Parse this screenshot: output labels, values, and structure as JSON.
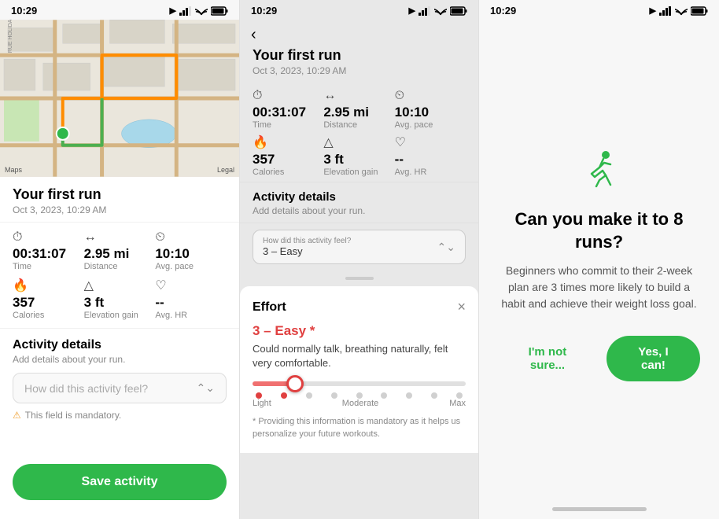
{
  "panel1": {
    "statusBar": {
      "time": "10:29",
      "locationIcon": "▶",
      "signal": "●●●",
      "wifi": "wifi",
      "battery": "battery"
    },
    "runTitle": "Your first run",
    "runDate": "Oct 3, 2023, 10:29 AM",
    "stats": [
      {
        "icon": "🕐",
        "value": "00:31:07",
        "label": "Time"
      },
      {
        "icon": "↔",
        "value": "2.95 mi",
        "label": "Distance"
      },
      {
        "icon": "⏱",
        "value": "10:10",
        "label": "Avg. pace"
      },
      {
        "icon": "🔥",
        "value": "357",
        "label": "Calories"
      },
      {
        "icon": "△",
        "value": "3 ft",
        "label": "Elevation gain"
      },
      {
        "icon": "♡",
        "value": "--",
        "label": "Avg. HR"
      }
    ],
    "activityDetails": {
      "title": "Activity details",
      "subtitle": "Add details about your run.",
      "dropdownPlaceholder": "How did this activity feel?",
      "mandatoryText": "This field is mandatory."
    },
    "saveButton": "Save activity",
    "legalText": "Legal",
    "appleMaps": "Maps"
  },
  "panel2": {
    "statusBar": {
      "time": "10:29"
    },
    "backLabel": "‹",
    "runTitle": "Your first run",
    "runDate": "Oct 3, 2023, 10:29 AM",
    "stats": [
      {
        "icon": "🕐",
        "value": "00:31:07",
        "label": "Time"
      },
      {
        "icon": "↔",
        "value": "2.95 mi",
        "label": "Distance"
      },
      {
        "icon": "⏱",
        "value": "10:10",
        "label": "Avg. pace"
      },
      {
        "icon": "🔥",
        "value": "357",
        "label": "Calories"
      },
      {
        "icon": "△",
        "value": "3 ft",
        "label": "Elevation gain"
      },
      {
        "icon": "♡",
        "value": "--",
        "label": "Avg. HR"
      }
    ],
    "activityDetails": {
      "title": "Activity details",
      "subtitle": "Add details about your run."
    },
    "dropdownLabel": "How did this activity feel?",
    "dropdownValue": "3 – Easy",
    "effortSheet": {
      "title": "Effort",
      "closeIcon": "×",
      "level": "3 – Easy *",
      "description": "Could normally talk, breathing naturally, felt very comfortable.",
      "sliderLabels": {
        "left": "Light",
        "center": "Moderate",
        "right": "Max"
      },
      "note": "* Providing this information is mandatory as it helps us personalize your future workouts."
    }
  },
  "panel3": {
    "statusBar": {
      "time": "10:29"
    },
    "challengeTitle": "Can you make it to 8 runs?",
    "challengeDesc": "Beginners who commit to their 2-week plan are 3 times more likely to build a habit and achieve their weight loss goal.",
    "buttonNotSure": "I'm not sure...",
    "buttonYes": "Yes, I can!"
  }
}
